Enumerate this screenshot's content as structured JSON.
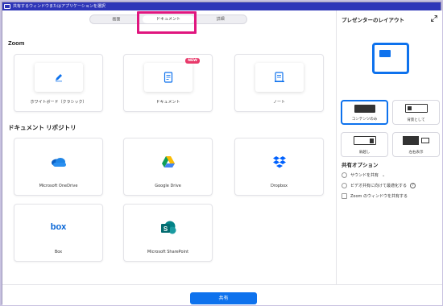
{
  "window": {
    "title": "共有するウィンドウまたはアプリケーションを選択"
  },
  "tabs": [
    {
      "label": "画面"
    },
    {
      "label": "ドキュメント"
    },
    {
      "label": "詳細"
    }
  ],
  "sections": {
    "zoom": {
      "title": "Zoom",
      "cards": [
        {
          "label": "ホワイトボード（クラシック）",
          "icon": "pen-icon"
        },
        {
          "label": "ドキュメント",
          "icon": "document-icon",
          "badge": "NEW"
        },
        {
          "label": "ノート",
          "icon": "notes-icon"
        }
      ]
    },
    "repo": {
      "title": "ドキュメント リポジトリ",
      "cards": [
        {
          "label": "Microsoft OneDrive",
          "icon": "onedrive-icon"
        },
        {
          "label": "Google Drive",
          "icon": "google-drive-icon"
        },
        {
          "label": "Dropbox",
          "icon": "dropbox-icon"
        },
        {
          "label": "Box",
          "icon": "box-icon"
        },
        {
          "label": "Microsoft SharePoint",
          "icon": "sharepoint-icon"
        }
      ]
    }
  },
  "footer": {
    "share_label": "共有"
  },
  "presenter": {
    "title": "プレゼンターのレイアウト",
    "layouts": [
      {
        "label": "コンテンツのみ",
        "selected": true
      },
      {
        "label": "背景として"
      },
      {
        "label": "肩越し"
      },
      {
        "label": "左右表示"
      }
    ]
  },
  "share_options": {
    "title": "共有オプション",
    "items": [
      {
        "label": "サウンドを共有"
      },
      {
        "label": "ビデオ共有に向けて最適化する"
      },
      {
        "label": "Zoom のウィンドウを共有する"
      }
    ]
  },
  "colors": {
    "accent": "#0e72ed",
    "highlight": "#e0167f",
    "titlebar": "#2e35b8"
  }
}
